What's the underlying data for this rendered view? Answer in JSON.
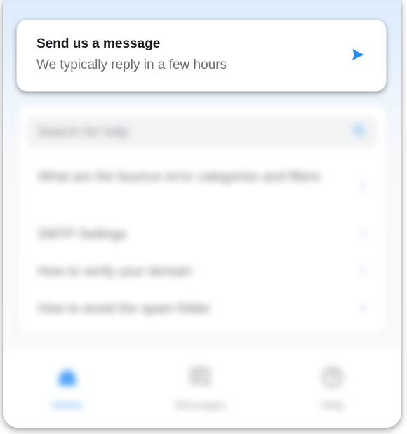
{
  "message_card": {
    "title": "Send us a message",
    "subtitle": "We typically reply in a few hours",
    "icon": "send-icon"
  },
  "help_search": {
    "placeholder": "Search for help",
    "icon": "search-icon"
  },
  "articles": [
    {
      "title": "What are the bounce error categories and filters"
    },
    {
      "title": "SMTP Settings"
    },
    {
      "title": "How to verify your domain"
    },
    {
      "title": "How to avoid the spam folder"
    }
  ],
  "bottom_nav": {
    "items": [
      {
        "label": "Home",
        "icon": "home-icon",
        "active": true
      },
      {
        "label": "Messages",
        "icon": "messages-icon",
        "active": false
      },
      {
        "label": "Help",
        "icon": "help-icon",
        "active": false
      }
    ]
  },
  "colors": {
    "accent": "#2a8df2",
    "header_gradient_top": "#dcebfc",
    "background": "#fafafa"
  }
}
